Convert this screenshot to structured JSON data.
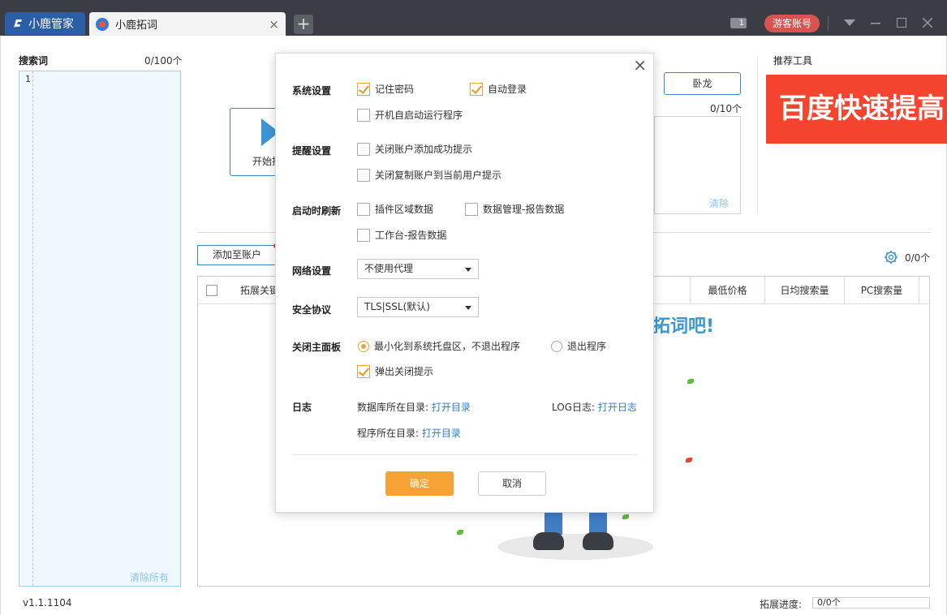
{
  "titlebar": {
    "brand": "小鹿管家",
    "tab_title": "小鹿拓词",
    "tab_close": "×",
    "new_tab": "+",
    "msg_count": "1",
    "guest_button": "游客账号"
  },
  "left_panel": {
    "title": "搜索词",
    "count": "0/100个",
    "line_number": "1",
    "clear_all": "清除所有",
    "version": "v1.1.1104"
  },
  "center": {
    "start_label": "开始拓词",
    "wolong_button": "卧龙",
    "right_count": "0/10个",
    "right_clear": "清除"
  },
  "recommend": {
    "title": "推荐工具",
    "banner_text": "百度快速提高"
  },
  "toolbar": {
    "add_to_account": "添加至账户",
    "result_count": "0/0个"
  },
  "table": {
    "columns": [
      "拓展关键词",
      "最低价格",
      "日均搜索量",
      "PC搜索量"
    ],
    "empty_message": "拓词吧!"
  },
  "progress": {
    "label": "拓展进度:",
    "value": "0/0个"
  },
  "dialog": {
    "close": "×",
    "system": {
      "label": "系统设置",
      "remember_password": {
        "label": "记住密码",
        "checked": true
      },
      "auto_login": {
        "label": "自动登录",
        "checked": true
      },
      "auto_start": {
        "label": "开机自启动运行程序",
        "checked": false
      }
    },
    "reminder": {
      "label": "提醒设置",
      "close_add_success": {
        "label": "关闭账户添加成功提示",
        "checked": false
      },
      "close_copy_account": {
        "label": "关闭复制账户到当前用户提示",
        "checked": false
      }
    },
    "refresh": {
      "label": "启动时刷新",
      "plugin_area": {
        "label": "插件区域数据",
        "checked": false
      },
      "data_mgmt_report": {
        "label": "数据管理-报告数据",
        "checked": false
      },
      "workbench_report": {
        "label": "工作台-报告数据",
        "checked": false
      }
    },
    "network": {
      "label": "网络设置",
      "proxy": "不使用代理"
    },
    "security": {
      "label": "安全协议",
      "protocol": "TLS|SSL(默认)"
    },
    "close_panel": {
      "label": "关闭主面板",
      "minimize": {
        "label": "最小化到系统托盘区，不退出程序",
        "selected": true
      },
      "exit": {
        "label": "退出程序",
        "selected": false
      },
      "popup_tip": {
        "label": "弹出关闭提示",
        "checked": true
      }
    },
    "log": {
      "label": "日志",
      "db_dir_label": "数据库所在目录:",
      "db_dir_link": "打开目录",
      "log_label": "LOG日志:",
      "log_link": "打开日志",
      "program_dir_label": "程序所在目录:",
      "program_dir_link": "打开目录"
    },
    "ok": "确定",
    "cancel": "取消"
  },
  "colors": {
    "accent_orange": "#f6a235",
    "brand_blue": "#2a5ea6",
    "banner_red": "#f6452e",
    "link_blue": "#2f80d1"
  }
}
